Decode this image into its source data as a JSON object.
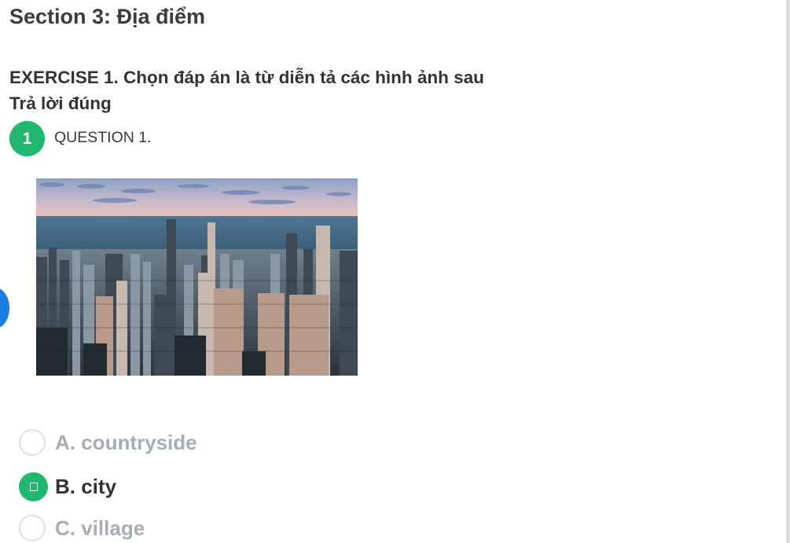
{
  "section": {
    "title": "Section 3: Địa điểm"
  },
  "exercise": {
    "title": "EXERCISE 1. Chọn đáp án là từ diễn tả các hình ảnh sau",
    "result": "Trả lời đúng"
  },
  "question": {
    "number": "1",
    "label": "QUESTION 1."
  },
  "answers": [
    {
      "label": "A. countryside",
      "selected": false
    },
    {
      "label": "B. city",
      "selected": true
    },
    {
      "label": "C. village",
      "selected": false
    }
  ],
  "colors": {
    "accent_green": "#1fb86e",
    "side_blue": "#1a7de4",
    "muted_text": "#a7acb5"
  }
}
